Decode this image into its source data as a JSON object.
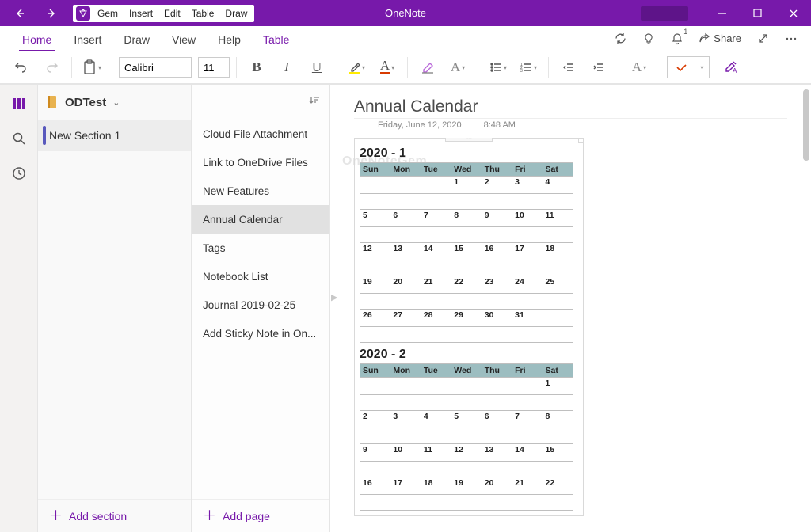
{
  "titlebar": {
    "app_name": "OneNote",
    "gem_menus": [
      "Gem",
      "Insert",
      "Edit",
      "Table",
      "Draw"
    ]
  },
  "tabs": {
    "items": [
      "Home",
      "Insert",
      "Draw",
      "View",
      "Help",
      "Table"
    ],
    "active_index": 0,
    "extra_purple_index": 5,
    "share_label": "Share",
    "bell_badge": "1"
  },
  "toolbar": {
    "font_name": "Calibri",
    "font_size": "11"
  },
  "notebook": {
    "name": "ODTest"
  },
  "sections": {
    "items": [
      "New Section 1"
    ],
    "add_label": "Add section"
  },
  "pages": {
    "items": [
      "Cloud File Attachment",
      "Link to OneDrive Files",
      "New Features",
      "Annual Calendar",
      "Tags",
      "Notebook List",
      "Journal 2019-02-25",
      "Add Sticky Note in On..."
    ],
    "selected_index": 3,
    "add_label": "Add page"
  },
  "page": {
    "title": "Annual Calendar",
    "date": "Friday, June 12, 2020",
    "time": "8:48 AM",
    "watermark": "OneNoteGem"
  },
  "calendars": [
    {
      "title": "2020 - 1",
      "dow": [
        "Sun",
        "Mon",
        "Tue",
        "Wed",
        "Thu",
        "Fri",
        "Sat"
      ],
      "rows": [
        [
          "",
          "",
          "",
          "1",
          "2",
          "3",
          "4"
        ],
        [
          "5",
          "6",
          "7",
          "8",
          "9",
          "10",
          "11"
        ],
        [
          "12",
          "13",
          "14",
          "15",
          "16",
          "17",
          "18"
        ],
        [
          "19",
          "20",
          "21",
          "22",
          "23",
          "24",
          "25"
        ],
        [
          "26",
          "27",
          "28",
          "29",
          "30",
          "31",
          ""
        ]
      ]
    },
    {
      "title": "2020 - 2",
      "dow": [
        "Sun",
        "Mon",
        "Tue",
        "Wed",
        "Thu",
        "Fri",
        "Sat"
      ],
      "rows": [
        [
          "",
          "",
          "",
          "",
          "",
          "",
          "1"
        ],
        [
          "2",
          "3",
          "4",
          "5",
          "6",
          "7",
          "8"
        ],
        [
          "9",
          "10",
          "11",
          "12",
          "13",
          "14",
          "15"
        ],
        [
          "16",
          "17",
          "18",
          "19",
          "20",
          "21",
          "22"
        ]
      ]
    }
  ]
}
